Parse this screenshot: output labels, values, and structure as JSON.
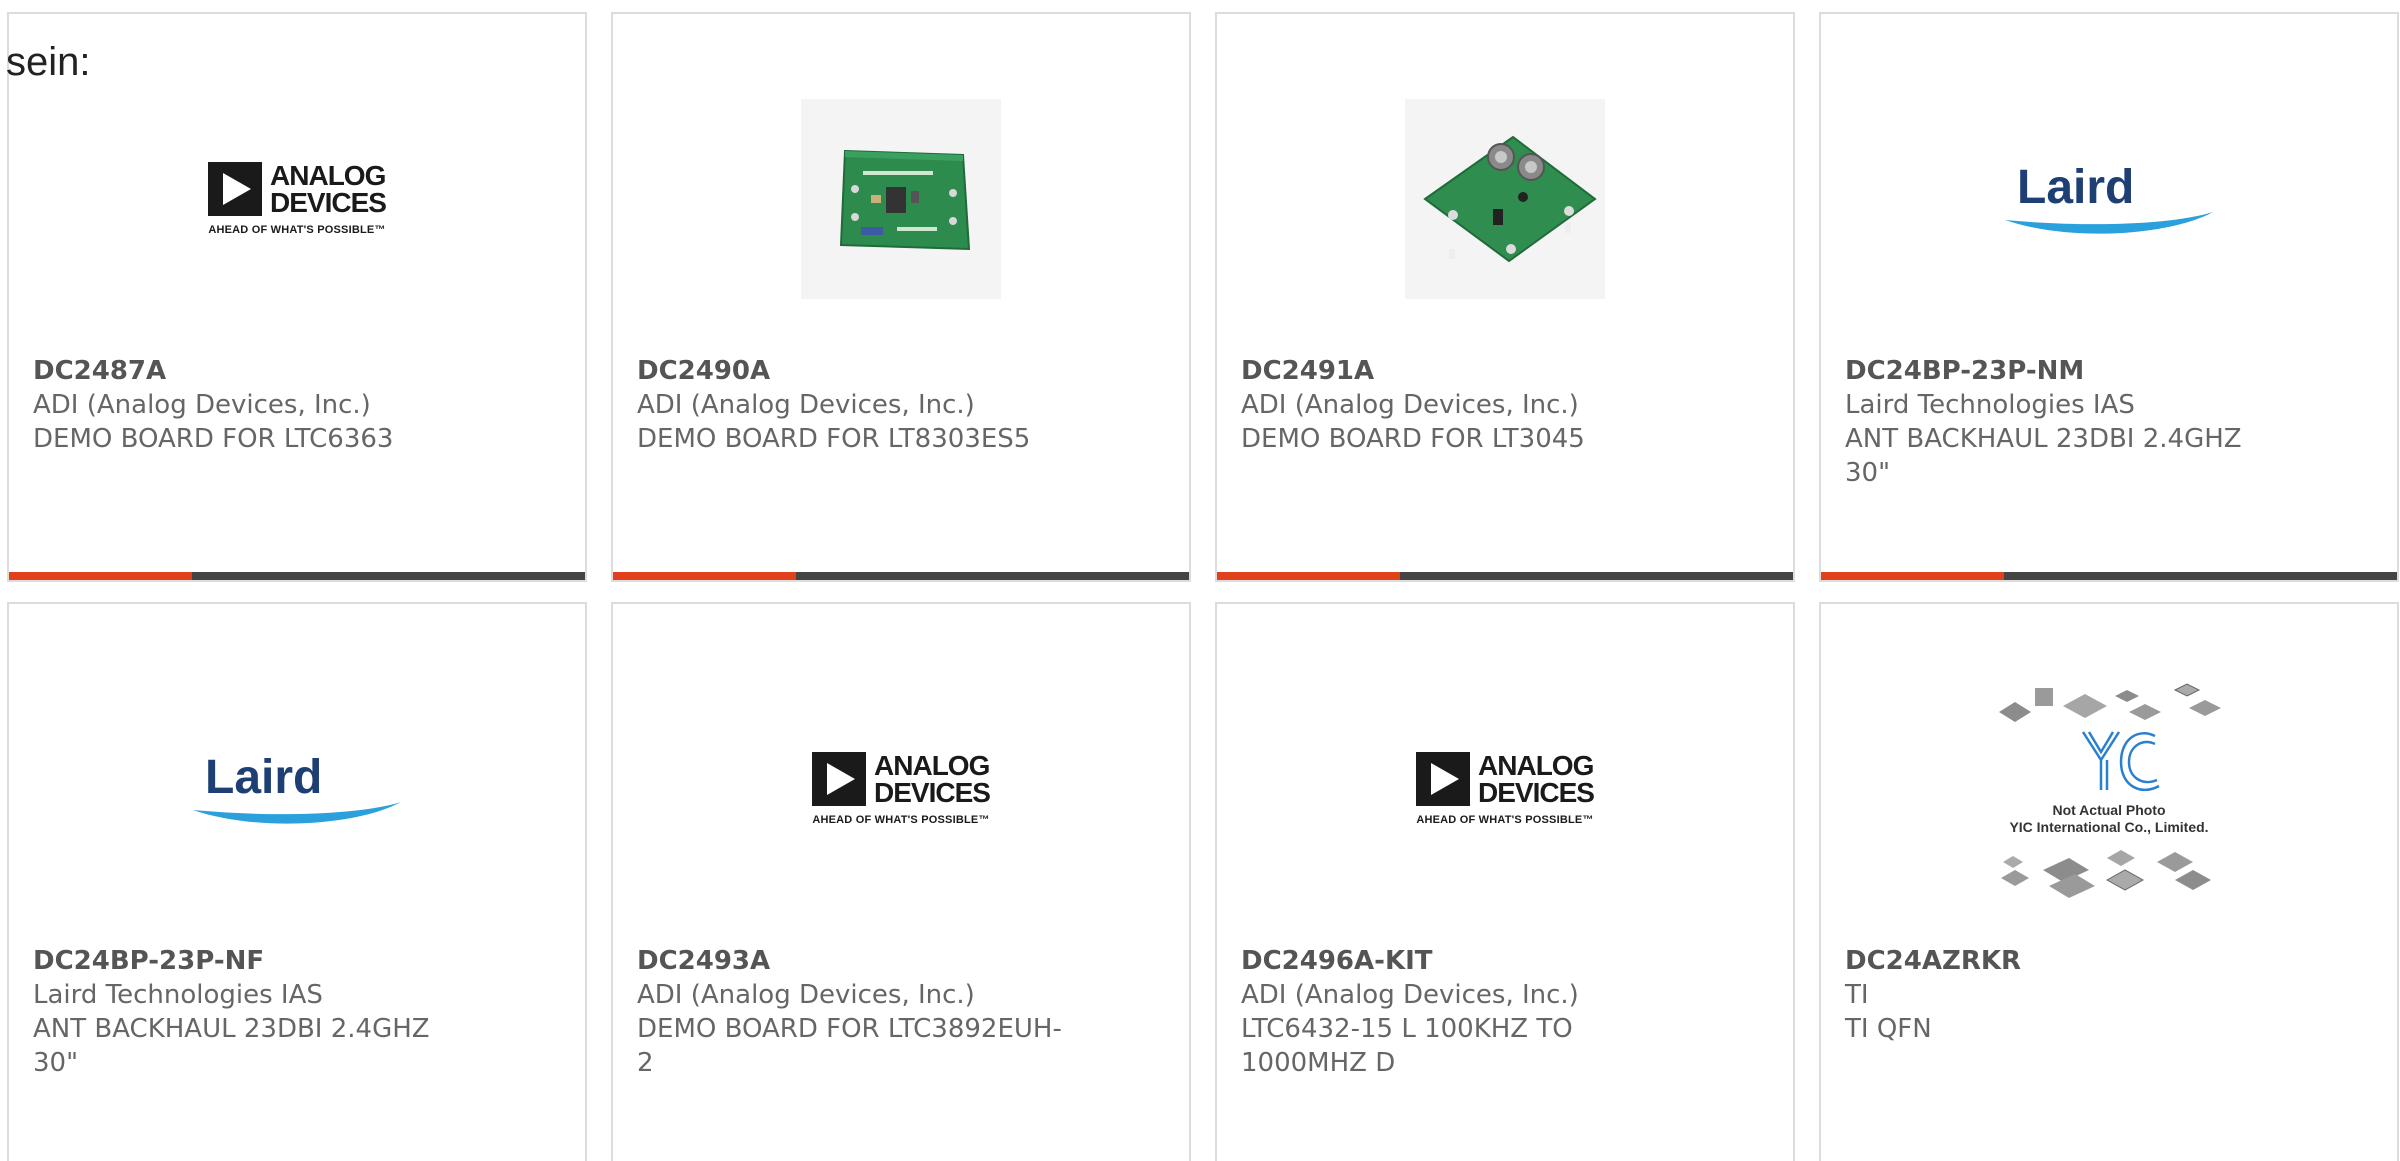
{
  "lead_text": "sein:",
  "colors": {
    "accent_bar": "#e0401a",
    "dark_bar": "#444444",
    "card_border": "#dcdcdc",
    "text": "#666666"
  },
  "brand_logos": {
    "adi": {
      "line1": "ANALOG",
      "line2": "DEVICES",
      "tagline": "AHEAD OF WHAT'S POSSIBLE™"
    },
    "laird": {
      "word": "Laird"
    },
    "yic": {
      "line1": "Not Actual Photo",
      "line2": "YIC International Co., Limited."
    }
  },
  "products": [
    {
      "part": "DC2487A",
      "maker": "ADI (Analog Devices, Inc.)",
      "desc": "DEMO BOARD FOR LTC6363",
      "image": "adi-logo"
    },
    {
      "part": "DC2490A",
      "maker": "ADI (Analog Devices, Inc.)",
      "desc": "DEMO BOARD FOR LT8303ES5",
      "image": "pcb-photo"
    },
    {
      "part": "DC2491A",
      "maker": "ADI (Analog Devices, Inc.)",
      "desc": "DEMO BOARD FOR LT3045",
      "image": "pcb-photo-connectors"
    },
    {
      "part": "DC24BP-23P-NM",
      "maker": "Laird Technologies IAS",
      "desc": "ANT BACKHAUL 23DBI 2.4GHZ 30\"",
      "image": "laird-logo"
    },
    {
      "part": "DC24BP-23P-NF",
      "maker": "Laird Technologies IAS",
      "desc": "ANT BACKHAUL 23DBI 2.4GHZ 30\"",
      "image": "laird-logo"
    },
    {
      "part": "DC2493A",
      "maker": "ADI (Analog Devices, Inc.)",
      "desc": "DEMO BOARD FOR LTC3892EUH-2",
      "image": "adi-logo"
    },
    {
      "part": "DC2496A-KIT",
      "maker": "ADI (Analog Devices, Inc.)",
      "desc": "LTC6432-15 L 100KHZ TO 1000MHZ D",
      "image": "adi-logo"
    },
    {
      "part": "DC24AZRKR",
      "maker": "TI",
      "desc": "TI QFN",
      "image": "yic-placeholder"
    }
  ]
}
